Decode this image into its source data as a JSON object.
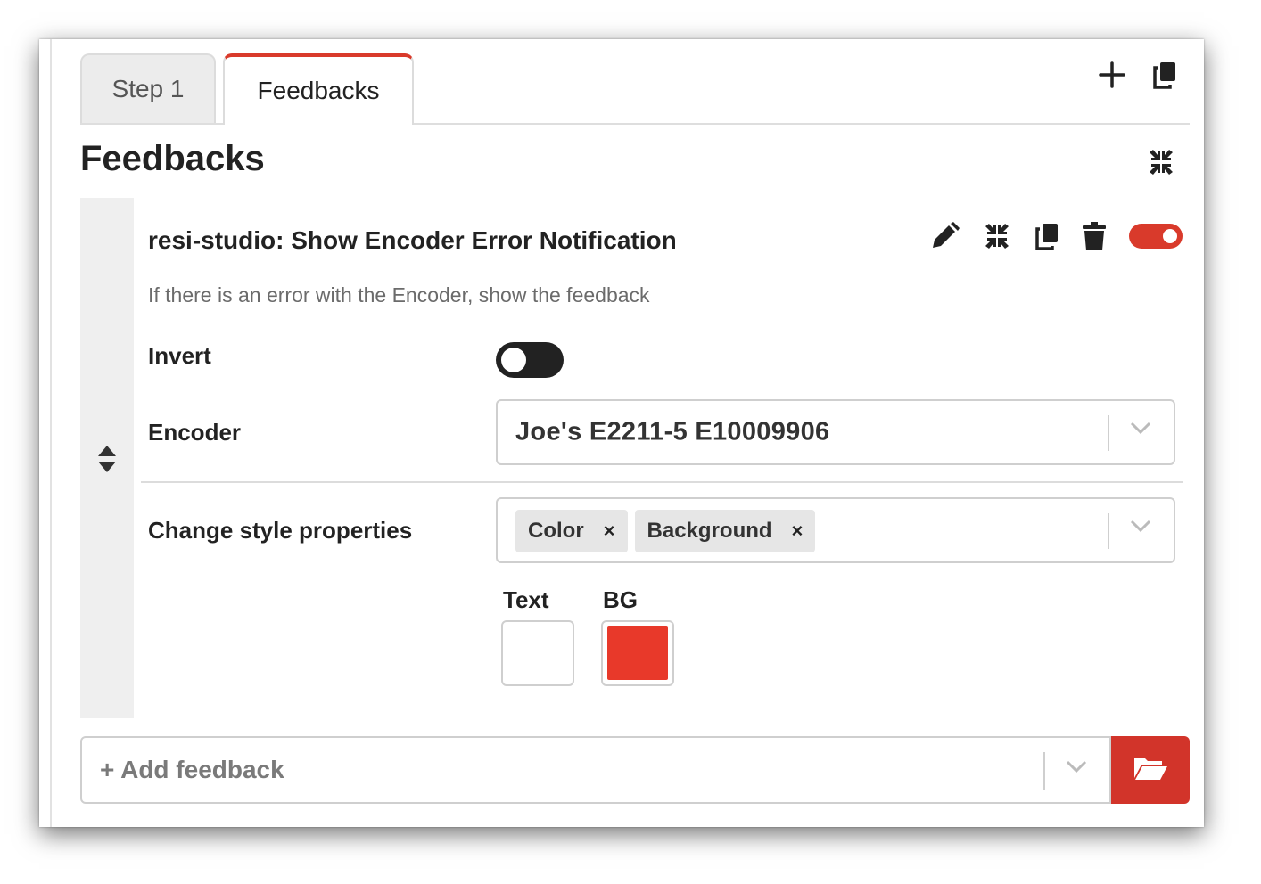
{
  "tabs": [
    {
      "label": "Step 1",
      "active": false
    },
    {
      "label": "Feedbacks",
      "active": true
    }
  ],
  "tab_actions": {
    "add_icon": "plus-icon",
    "duplicate_icon": "copy-icon"
  },
  "section": {
    "title": "Feedbacks",
    "collapse_icon": "collapse-icon"
  },
  "feedback": {
    "title": "resi-studio: Show Encoder Error Notification",
    "description": "If there is an error with the Encoder, show the feedback",
    "actions": [
      "pencil-icon",
      "collapse-icon",
      "copy-icon",
      "trash-icon"
    ],
    "enabled": true,
    "fields": {
      "invert": {
        "label": "Invert",
        "value": false
      },
      "encoder": {
        "label": "Encoder",
        "value": "Joe's E2211-5 E10009906"
      },
      "style_props": {
        "label": "Change style properties",
        "chips": [
          {
            "label": "Color",
            "remove": "×"
          },
          {
            "label": "Background",
            "remove": "×"
          }
        ]
      },
      "colors": {
        "text_label": "Text",
        "bg_label": "BG",
        "text_color": "#ffffff",
        "bg_color": "#e8392a"
      }
    }
  },
  "add_feedback": {
    "placeholder": "+ Add feedback",
    "folder_icon": "folder-open-icon"
  },
  "colors": {
    "accent": "#d93a2b",
    "folder_button": "#d2342a"
  }
}
